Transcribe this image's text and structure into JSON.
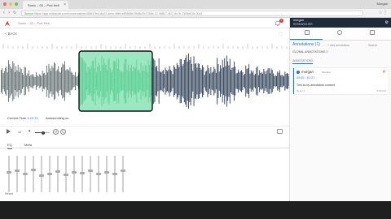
{
  "browser": {
    "tab_title": "Sonix – 03 – Pod Hell",
    "profile": "Morgan",
    "url_secure": "Secure",
    "url": "https://app.criticsuite.com/conversations/88847fe4-6a22-4ebc-86fd-e85866b78c8b/2b7765d-12-08817-4f17-6c7b-7305e81b-00c0"
  },
  "app": {
    "breadcrumb": "Sonix – 03 – Pod Hell...",
    "notification_count": "4",
    "back_label": "< BACK"
  },
  "player": {
    "current_time_label": "Current Time",
    "current_time_value": "1:22.70",
    "autoscroll_label": "Autoscrolling on",
    "speed": "1x",
    "volume_fraction": 0.55,
    "tab_eq": "EQ",
    "tab_meta": "Meta",
    "reset_label": "Reset",
    "eq_levels": [
      0.55,
      0.6,
      0.5,
      0.62,
      0.45,
      0.5,
      0.58,
      0.48,
      0.55,
      0.52,
      0.6,
      0.5,
      0.55,
      0.5,
      0.6
    ]
  },
  "colors": {
    "wave_played": "#5f6b6e",
    "wave_selected": "#5fcf95",
    "wave_selected_bg": "#9be8c0",
    "wave_unplayed": "#2c3e55",
    "accent": "#2b6fd6"
  },
  "panel": {
    "user_name": "morgan",
    "user_role": "RESEARCHER",
    "annotations_title": "Annotations (1)",
    "action_add": "+ Add annotation",
    "action_search": "Search",
    "global_label": "GLOBAL ANNOTATIONS",
    "global_count": "0",
    "annotations_label": "ANNOTATIONS"
  },
  "annotation": {
    "user": "morgan",
    "tag": "Member",
    "time_range": "00:45 - 01:21",
    "text": "This is my annotation content",
    "reply": "Reply 0",
    "date": "04/20/18"
  }
}
